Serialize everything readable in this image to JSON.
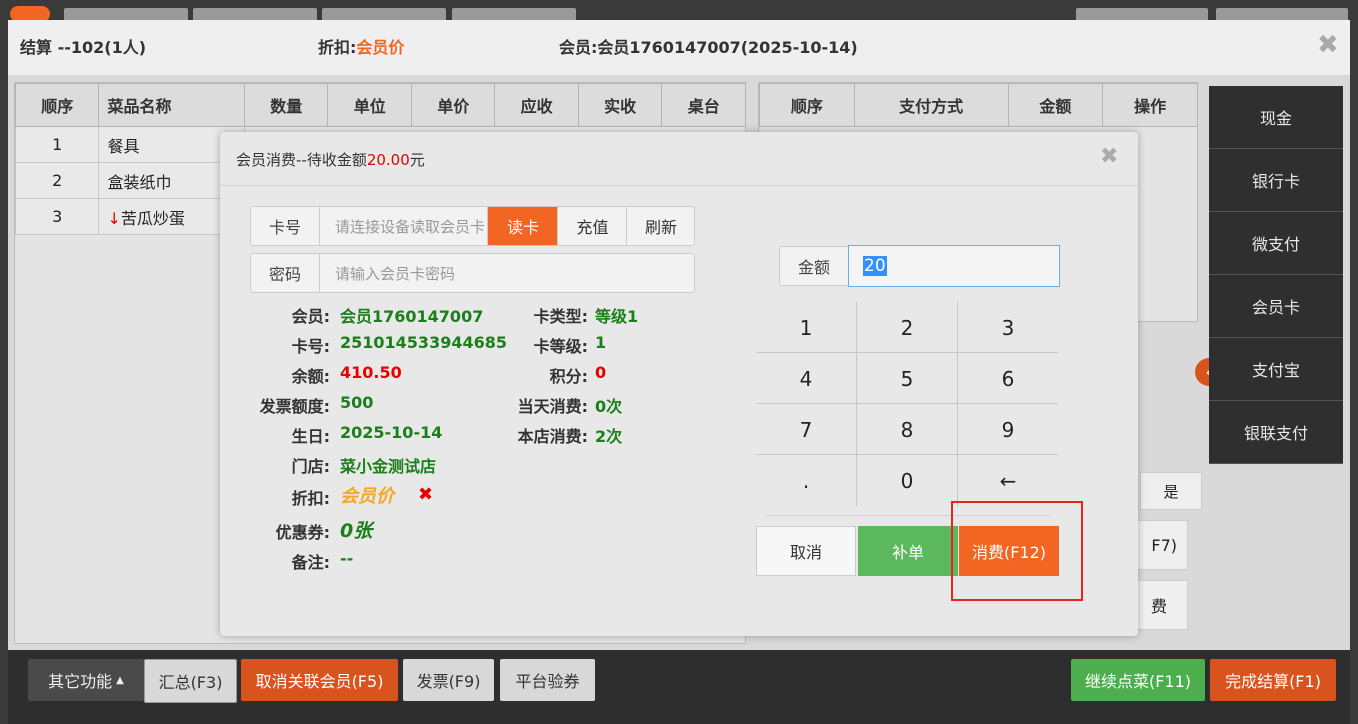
{
  "settle": {
    "title": "结算 --102(1人)",
    "discount_label": "折扣:",
    "discount_value": "会员价",
    "member_label": "会员:",
    "member_value": "会员1760147007(2025-10-14)"
  },
  "items_table": {
    "headers": [
      "顺序",
      "菜品名称",
      "数量",
      "单位",
      "单价",
      "应收",
      "实收",
      "桌台"
    ],
    "rows": [
      {
        "seq": "1",
        "name": "餐具",
        "marker": ""
      },
      {
        "seq": "2",
        "name": "盒装纸巾",
        "marker": ""
      },
      {
        "seq": "3",
        "name": "苦瓜炒蛋",
        "marker": "↓"
      }
    ]
  },
  "pay_table": {
    "headers": [
      "顺序",
      "支付方式",
      "金额",
      "操作"
    ]
  },
  "payment_methods": [
    "现金",
    "银行卡",
    "微支付",
    "会员卡",
    "支付宝",
    "银联支付"
  ],
  "behind_fragments": {
    "yes_btn": "是",
    "f7_fragment": "F7)",
    "fee_fragment": "费"
  },
  "bottom": {
    "other": "其它功能",
    "summary": "汇总(F3)",
    "cancel_member": "取消关联会员(F5)",
    "invoice": "发票(F9)",
    "platform": "平台验券",
    "continue": "继续点菜(F11)",
    "finish": "完成结算(F1)"
  },
  "modal": {
    "title_prefix": "会员消费--待收金额",
    "title_amount": "20.00",
    "title_suffix": "元",
    "card_label": "卡号",
    "card_placeholder": "请连接设备读取会员卡",
    "read_card": "读卡",
    "recharge": "充值",
    "refresh": "刷新",
    "pwd_label": "密码",
    "pwd_placeholder": "请输入会员卡密码",
    "info": {
      "member_l": "会员:",
      "member_v": "会员1760147007",
      "cardno_l": "卡号:",
      "cardno_v": "251014533944685",
      "balance_l": "余额:",
      "balance_v": "410.50",
      "invoice_l": "发票额度:",
      "invoice_v": "500",
      "birthday_l": "生日:",
      "birthday_v": "2025-10-14",
      "store_l": "门店:",
      "store_v": "菜小金测试店",
      "discount_l": "折扣:",
      "discount_v": "会员价",
      "coupon_l": "优惠券:",
      "coupon_v": "0张",
      "note_l": "备注:",
      "note_v": "--",
      "cardtype_l": "卡类型:",
      "cardtype_v": "等级1",
      "cardlevel_l": "卡等级:",
      "cardlevel_v": "1",
      "points_l": "积分:",
      "points_v": "0",
      "today_l": "当天消费:",
      "today_v": "0次",
      "store_spend_l": "本店消费:",
      "store_spend_v": "2次"
    },
    "amount_label": "金额",
    "amount_value": "20",
    "keys": [
      "1",
      "2",
      "3",
      "4",
      "5",
      "6",
      "7",
      "8",
      "9",
      ".",
      "0",
      "←"
    ],
    "cancel": "取消",
    "supplement": "补单",
    "consume": "消费(F12)"
  },
  "colors": {
    "orange": "#f26522",
    "green": "#5cb85c",
    "red": "#e60000",
    "dark": "#2f2f2f"
  }
}
